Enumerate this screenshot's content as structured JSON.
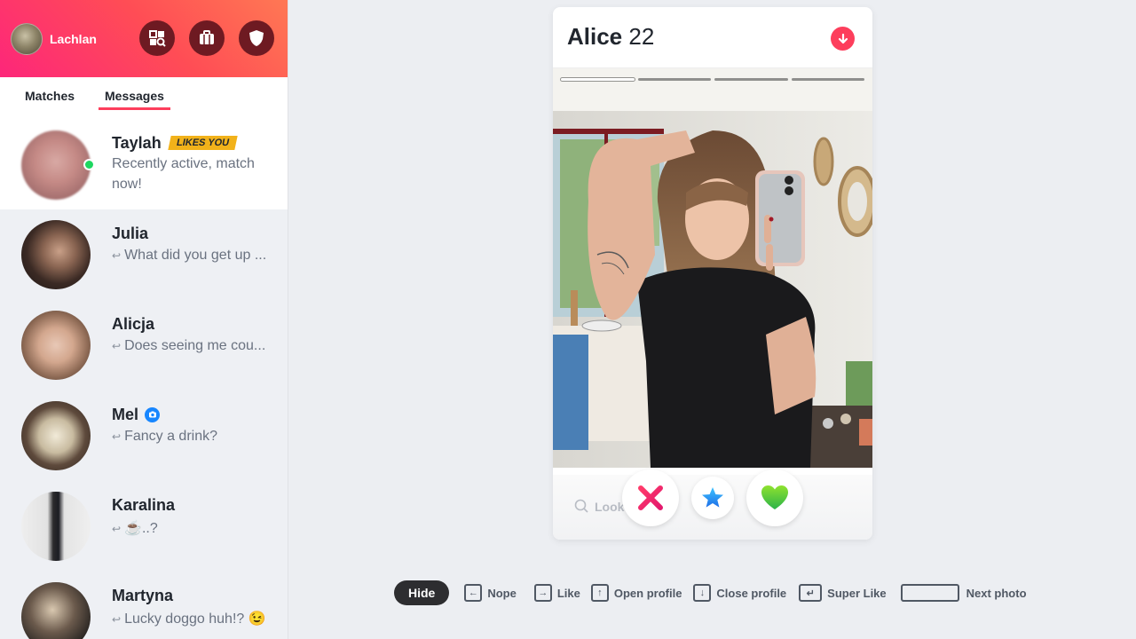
{
  "user": {
    "name": "Lachlan"
  },
  "tabs": [
    {
      "label": "Matches"
    },
    {
      "label": "Messages"
    }
  ],
  "conversations": [
    {
      "name": "Taylah",
      "badge": "LIKES YOU",
      "message": "Recently active, match now!"
    },
    {
      "name": "Julia",
      "message": "What did you get up ..."
    },
    {
      "name": "Alicja",
      "message": "Does seeing me cou..."
    },
    {
      "name": "Mel",
      "message": "Fancy a drink?"
    },
    {
      "name": "Karalina",
      "message": "☕..?"
    },
    {
      "name": "Martyna",
      "message": "Lucky doggo huh!? 😉"
    }
  ],
  "profile": {
    "name": "Alice",
    "age": "22",
    "photo_count": 4,
    "active_photo": 1
  },
  "search": {
    "hint": "Look"
  },
  "shortcuts": {
    "hide": "Hide",
    "nope": "Nope",
    "like": "Like",
    "open_profile": "Open profile",
    "close_profile": "Close profile",
    "super_like": "Super Like",
    "next_photo": "Next photo"
  },
  "colors": {
    "brand_gradient_start": "#fd267a",
    "brand_gradient_end": "#ff7854",
    "tab_underline": "#fd3e5c",
    "online_dot": "#1ed760",
    "badge": "#f2b21a"
  }
}
